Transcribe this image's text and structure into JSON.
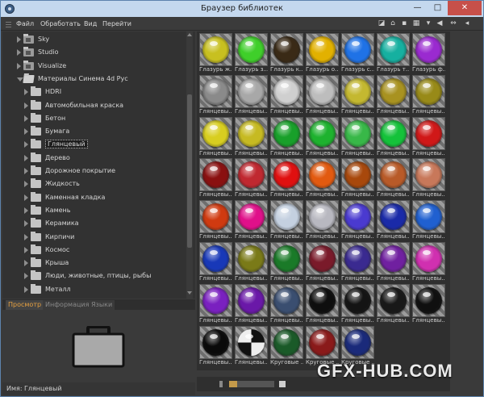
{
  "window": {
    "title": "Браузер библиотек",
    "minimize": "—",
    "maximize": "□",
    "close": "✕"
  },
  "menu": [
    "Файл",
    "Обработать",
    "Вид",
    "Перейти"
  ],
  "toolbar_icons": [
    "thumbnails-view-icon",
    "home-icon",
    "back-icon",
    "list-view-icon",
    "layout-icon",
    "arrow-left-icon",
    "link-icon"
  ],
  "tree": [
    {
      "label": "Sky",
      "indent": 0,
      "icon": "catalog",
      "expanded": false
    },
    {
      "label": "Studio",
      "indent": 0,
      "icon": "catalog",
      "expanded": false
    },
    {
      "label": "Visualize",
      "indent": 0,
      "icon": "catalog",
      "expanded": false
    },
    {
      "label": "Материалы Синема 4d Рус",
      "indent": 0,
      "icon": "open-folder",
      "expanded": true
    },
    {
      "label": "HDRI",
      "indent": 1,
      "icon": "folder",
      "expanded": false
    },
    {
      "label": "Автомобильная краска",
      "indent": 1,
      "icon": "folder",
      "expanded": false
    },
    {
      "label": "Бетон",
      "indent": 1,
      "icon": "folder",
      "expanded": false
    },
    {
      "label": "Бумага",
      "indent": 1,
      "icon": "folder",
      "expanded": false
    },
    {
      "label": "Глянцевый",
      "indent": 1,
      "icon": "folder",
      "expanded": false,
      "selected": true
    },
    {
      "label": "Дерево",
      "indent": 1,
      "icon": "folder",
      "expanded": false
    },
    {
      "label": "Дорожное покрытие",
      "indent": 1,
      "icon": "folder",
      "expanded": false
    },
    {
      "label": "Жидкость",
      "indent": 1,
      "icon": "folder",
      "expanded": false
    },
    {
      "label": "Каменная кладка",
      "indent": 1,
      "icon": "folder",
      "expanded": false
    },
    {
      "label": "Камень",
      "indent": 1,
      "icon": "folder",
      "expanded": false
    },
    {
      "label": "Керамика",
      "indent": 1,
      "icon": "folder",
      "expanded": false
    },
    {
      "label": "Кирпичи",
      "indent": 1,
      "icon": "folder",
      "expanded": false
    },
    {
      "label": "Космос",
      "indent": 1,
      "icon": "folder",
      "expanded": false
    },
    {
      "label": "Крыша",
      "indent": 1,
      "icon": "folder",
      "expanded": false
    },
    {
      "label": "Люди, животные, птицы, рыбы",
      "indent": 1,
      "icon": "folder",
      "expanded": false
    },
    {
      "label": "Металл",
      "indent": 1,
      "icon": "folder",
      "expanded": false
    }
  ],
  "tabs": [
    {
      "label": "Просмотр",
      "active": true
    },
    {
      "label": "Информация",
      "active": false
    },
    {
      "label": "Языки",
      "active": false
    }
  ],
  "preview": {
    "icon": "briefcase-icon"
  },
  "name_field": {
    "label": "Имя:",
    "value": "Глянцевый"
  },
  "materials": [
    {
      "name": "Глазурь ж...",
      "color": "#c8c020"
    },
    {
      "name": "Глазурь з...",
      "color": "#3fcf2a"
    },
    {
      "name": "Глазурь к...",
      "color": "#3a2a16"
    },
    {
      "name": "Глазурь о...",
      "color": "#e2b100"
    },
    {
      "name": "Глазурь с...",
      "color": "#1f72e6"
    },
    {
      "name": "Глазурь т...",
      "color": "#16b0a0"
    },
    {
      "name": "Глазурь ф...",
      "color": "#9a2ad0"
    },
    {
      "name": "Глянцевы...",
      "color": "#8a8a8a"
    },
    {
      "name": "Глянцевы...",
      "color": "#a8a8a8"
    },
    {
      "name": "Глянцевы...",
      "color": "#cfcfcf"
    },
    {
      "name": "Глянцевы...",
      "color": "#bdbdbd"
    },
    {
      "name": "Глянцевы...",
      "color": "#c4b830"
    },
    {
      "name": "Глянцевы...",
      "color": "#a89220"
    },
    {
      "name": "Глянцевы...",
      "color": "#988a18"
    },
    {
      "name": "Глянцевы...",
      "color": "#d8ce20"
    },
    {
      "name": "Глянцевы...",
      "color": "#c6ba22"
    },
    {
      "name": "Глянцевы...",
      "color": "#18a02a"
    },
    {
      "name": "Глянцевы...",
      "color": "#1eb22e"
    },
    {
      "name": "Глянцевы...",
      "color": "#38b848"
    },
    {
      "name": "Глянцевы...",
      "color": "#14c23a"
    },
    {
      "name": "Глянцевы...",
      "color": "#d01818"
    },
    {
      "name": "Глянцевы...",
      "color": "#8a1010"
    },
    {
      "name": "Глянцевы...",
      "color": "#c02830"
    },
    {
      "name": "Глянцевы...",
      "color": "#e01010"
    },
    {
      "name": "Глянцевы...",
      "color": "#e25a10"
    },
    {
      "name": "Глянцевы...",
      "color": "#a8480c"
    },
    {
      "name": "Глянцевы...",
      "color": "#b85a28"
    },
    {
      "name": "Глянцевы...",
      "color": "#c8785a"
    },
    {
      "name": "Глянцевы...",
      "color": "#d03a10"
    },
    {
      "name": "Глянцевы...",
      "color": "#e0108a"
    },
    {
      "name": "Глянцевы...",
      "color": "#c4d0e0"
    },
    {
      "name": "Глянцевы...",
      "color": "#b8b8c0"
    },
    {
      "name": "Глянцевы...",
      "color": "#4a3ad0"
    },
    {
      "name": "Глянцевы...",
      "color": "#1a2aa8"
    },
    {
      "name": "Глянцевы...",
      "color": "#2060d0"
    },
    {
      "name": "Глянцевы...",
      "color": "#1838b8"
    },
    {
      "name": "Глянцевы...",
      "color": "#7a7a18"
    },
    {
      "name": "Глянцевы...",
      "color": "#1a7a28"
    },
    {
      "name": "Глянцевы...",
      "color": "#7a1a2a"
    },
    {
      "name": "Глянцевы...",
      "color": "#3a2a90"
    },
    {
      "name": "Глянцевы...",
      "color": "#7020a0"
    },
    {
      "name": "Глянцевы...",
      "color": "#d030b0"
    },
    {
      "name": "Глянцевы...",
      "color": "#7a20c0"
    },
    {
      "name": "Глянцевы...",
      "color": "#6a18a8"
    },
    {
      "name": "Глянцевы...",
      "color": "#3a4e70"
    },
    {
      "name": "Глянцевы...",
      "color": "#0e0e0e"
    },
    {
      "name": "Глянцевы...",
      "color": "#141414"
    },
    {
      "name": "Глянцевы...",
      "color": "#181818"
    },
    {
      "name": "Глянцевы...",
      "color": "#101010"
    },
    {
      "name": "Глянцевы...",
      "color": "#0a0a0a"
    },
    {
      "name": "Глянцевы...",
      "color": "checker"
    },
    {
      "name": "Круговые ...",
      "color": "#1a5a28"
    },
    {
      "name": "Круговые ...",
      "color": "#8a1a1a"
    },
    {
      "name": "Круговые ...",
      "color": "#1a2a7a"
    }
  ],
  "watermark": "GFX-HUB.COM"
}
